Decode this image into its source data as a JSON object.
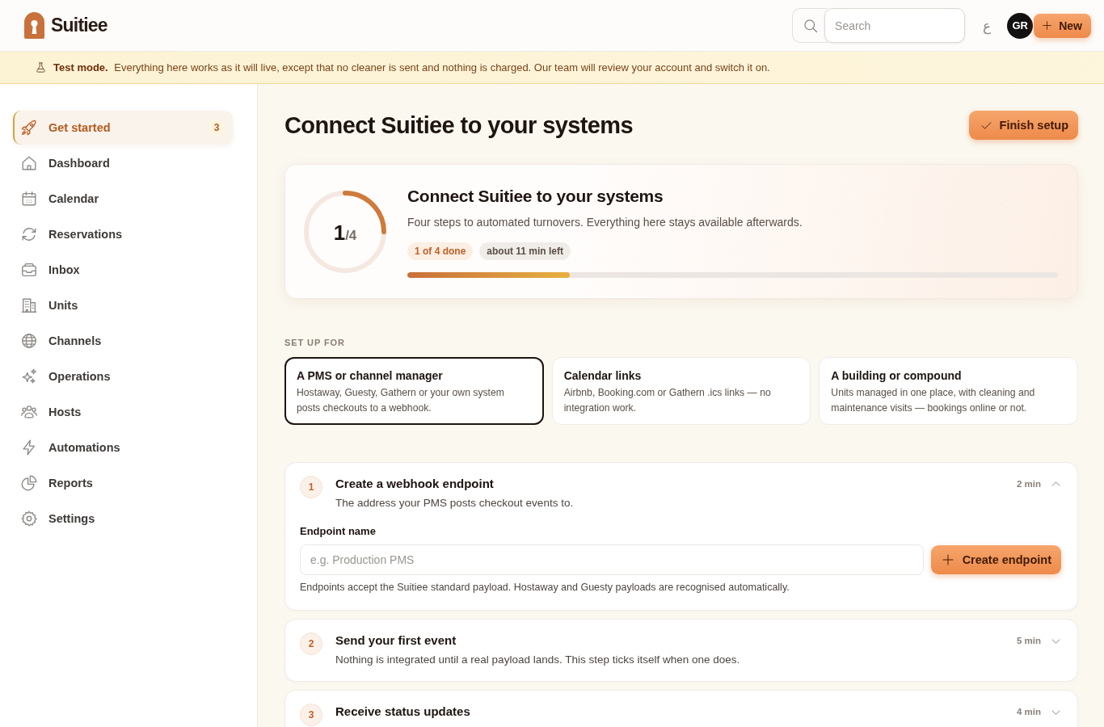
{
  "header": {
    "logo_text": "Suitiee",
    "search": {
      "placeholder": "Search"
    },
    "language_toggle": "ع",
    "avatar": {
      "initials": "GR"
    },
    "new_button": {
      "label": "New"
    }
  },
  "banner": {
    "message": "**Test mode.** Everything here works as it will live, except that no cleaner is sent and nothing is charged. Our team will review your account and switch it on."
  },
  "sidebar": {
    "items": [
      {
        "label": "Get started",
        "selected": true,
        "badge": "3"
      },
      {
        "label": "Dashboard",
        "selected": false
      },
      {
        "label": "Calendar",
        "selected": false
      },
      {
        "label": "Reservations",
        "selected": false
      },
      {
        "label": "Inbox",
        "selected": false
      },
      {
        "label": "Units",
        "selected": false
      },
      {
        "label": "Channels",
        "selected": false
      },
      {
        "label": "Operations",
        "selected": false
      },
      {
        "label": "Hosts",
        "selected": false
      },
      {
        "label": "Automations",
        "selected": false
      },
      {
        "label": "Reports",
        "selected": false
      },
      {
        "label": "Settings",
        "selected": false
      }
    ]
  },
  "page": {
    "title": "Connect Suitiee to your systems",
    "finish_button": {
      "label": "Finish setup"
    }
  },
  "progress_card": {
    "ring": {
      "count": "1",
      "total": "/4"
    },
    "title": "Connect Suitiee to your systems",
    "subtitle": "Four steps to automated turnovers. Everything here stays available afterwards.",
    "pills": [
      {
        "label": "1 of 4 done",
        "kind": "accent"
      },
      {
        "label": "about 11 min left",
        "kind": "neutral"
      }
    ],
    "progress_bar": {
      "level": 0.25
    }
  },
  "setup_for": {
    "label": "SET UP FOR",
    "options": [
      {
        "title": "A PMS or channel manager",
        "description": "Hostaway, Guesty, Gathern or your own system posts checkouts to a webhook.",
        "selected": true
      },
      {
        "title": "Calendar links",
        "description": "Airbnb, Booking.com or Gathern .ics links — no integration work.",
        "selected": false
      },
      {
        "title": "A building or compound",
        "description": "Units managed in one place, with cleaning and maintenance visits — bookings online or not.",
        "selected": false
      }
    ]
  },
  "steps": [
    {
      "number": "1",
      "title": "Create a webhook endpoint",
      "description": "The address your PMS posts checkout events to.",
      "duration": "2 min",
      "expanded": true,
      "form": {
        "label": "Endpoint name",
        "placeholder": "e.g. Production PMS",
        "button": "Create endpoint",
        "help": "Endpoints accept the Suitiee standard payload. Hostaway and Guesty payloads are recognised automatically."
      }
    },
    {
      "number": "2",
      "title": "Send your first event",
      "description": "Nothing is integrated until a real payload lands. This step ticks itself when one does.",
      "duration": "5 min",
      "expanded": false
    },
    {
      "number": "3",
      "title": "Receive status updates",
      "duration": "4 min",
      "expanded": false
    }
  ]
}
